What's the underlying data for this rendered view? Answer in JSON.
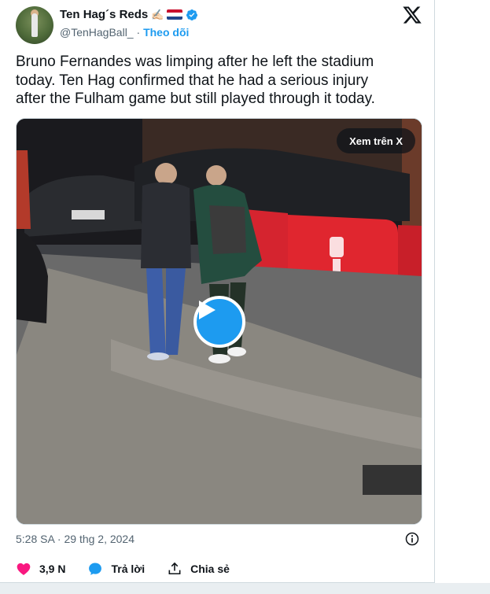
{
  "author": {
    "name": "Ten Hag´s Reds",
    "name_emoji": "✍🏻",
    "handle": "@TenHagBall_",
    "separator": "·",
    "follow_label": "Theo dõi"
  },
  "tweet": {
    "text": "Bruno Fernandes was limping after he left the stadium\ntoday. Ten Hag confirmed that he had a serious injury\nafter the Fulham game but still played through it today."
  },
  "media": {
    "watch_label": "Xem trên X"
  },
  "meta": {
    "timestamp": "5:28 SA · 29 thg 2, 2024"
  },
  "actions": {
    "likes": "3,9 N",
    "reply_label": "Trả lời",
    "share_label": "Chia sẻ"
  },
  "colors": {
    "accent": "#1d9bf0",
    "like": "#f91880",
    "text_secondary": "#536471"
  },
  "icons": [
    "x-logo-icon",
    "verified-badge-icon",
    "play-icon",
    "info-icon",
    "heart-icon",
    "reply-icon",
    "share-icon"
  ]
}
